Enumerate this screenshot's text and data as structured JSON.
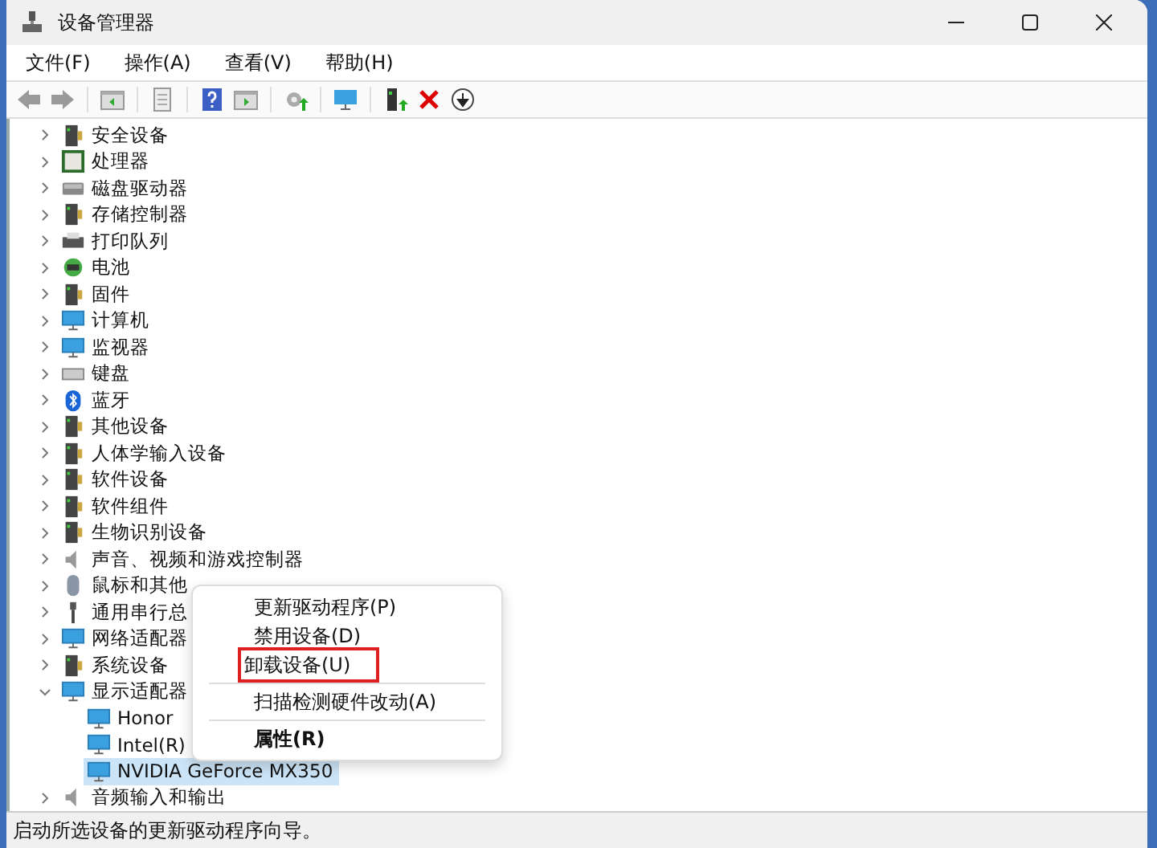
{
  "window": {
    "title": "设备管理器"
  },
  "menu": [
    "文件(F)",
    "操作(A)",
    "查看(V)",
    "帮助(H)"
  ],
  "tree": [
    {
      "label": "安全设备",
      "expanded": false,
      "selected": false
    },
    {
      "label": "处理器",
      "expanded": false,
      "selected": false
    },
    {
      "label": "磁盘驱动器",
      "expanded": false,
      "selected": false
    },
    {
      "label": "存储控制器",
      "expanded": false,
      "selected": false
    },
    {
      "label": "打印队列",
      "expanded": false,
      "selected": false
    },
    {
      "label": "电池",
      "expanded": false,
      "selected": false
    },
    {
      "label": "固件",
      "expanded": false,
      "selected": false
    },
    {
      "label": "计算机",
      "expanded": false,
      "selected": false
    },
    {
      "label": "监视器",
      "expanded": false,
      "selected": false
    },
    {
      "label": "键盘",
      "expanded": false,
      "selected": false
    },
    {
      "label": "蓝牙",
      "expanded": false,
      "selected": false
    },
    {
      "label": "其他设备",
      "expanded": false,
      "selected": false
    },
    {
      "label": "人体学输入设备",
      "expanded": false,
      "selected": false
    },
    {
      "label": "软件设备",
      "expanded": false,
      "selected": false
    },
    {
      "label": "软件组件",
      "expanded": false,
      "selected": false
    },
    {
      "label": "生物识别设备",
      "expanded": false,
      "selected": false
    },
    {
      "label": "声音、视频和游戏控制器",
      "expanded": false,
      "selected": false
    },
    {
      "label": "鼠标和其他",
      "expanded": false,
      "selected": false
    },
    {
      "label": "通用串行总",
      "expanded": false,
      "selected": false
    },
    {
      "label": "网络适配器",
      "expanded": false,
      "selected": false
    },
    {
      "label": "系统设备",
      "expanded": false,
      "selected": false
    },
    {
      "label": "显示适配器",
      "expanded": true,
      "selected": false,
      "children": [
        {
          "label": "Honor",
          "selected": false
        },
        {
          "label": "Intel(R)",
          "selected": false
        },
        {
          "label": "NVIDIA GeForce MX350",
          "selected": true
        }
      ]
    },
    {
      "label": "音频输入和输出",
      "expanded": false,
      "selected": false
    }
  ],
  "context_menu": {
    "items": [
      {
        "kind": "item",
        "label": "更新驱动程序(P)",
        "bold": false,
        "outlined": false
      },
      {
        "kind": "item",
        "label": "禁用设备(D)",
        "bold": false,
        "outlined": false
      },
      {
        "kind": "item",
        "label": "卸载设备(U)",
        "bold": false,
        "outlined": true
      },
      {
        "kind": "separator"
      },
      {
        "kind": "item",
        "label": "扫描检测硬件改动(A)",
        "bold": false,
        "outlined": false
      },
      {
        "kind": "separator"
      },
      {
        "kind": "item",
        "label": "属性(R)",
        "bold": true,
        "outlined": false
      }
    ]
  },
  "status_bar": "启动所选设备的更新驱动程序向导。"
}
